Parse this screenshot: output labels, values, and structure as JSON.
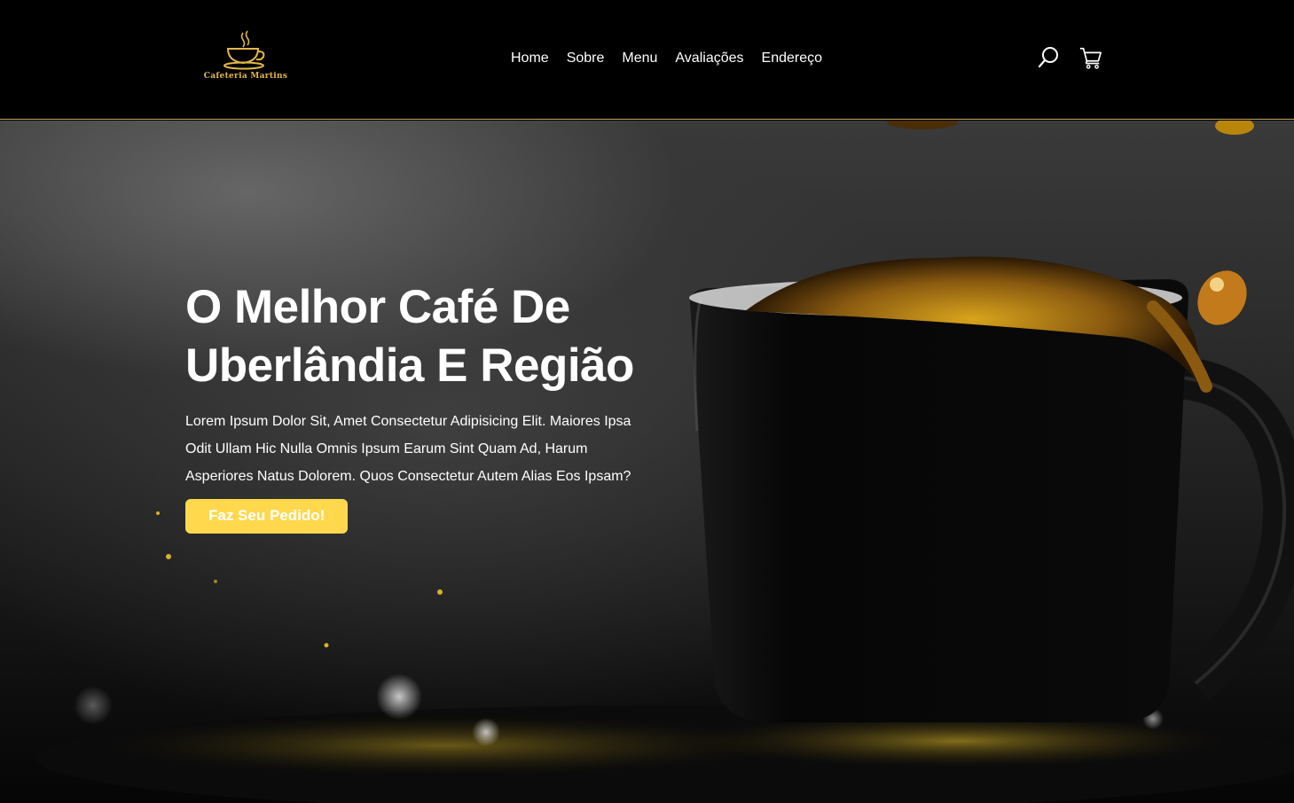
{
  "header": {
    "logo_text": "Cafeteria Martins",
    "nav": [
      {
        "label": "Home"
      },
      {
        "label": "Sobre"
      },
      {
        "label": "Menu"
      },
      {
        "label": "Avaliações"
      },
      {
        "label": "Endereço"
      }
    ],
    "icons": [
      "search-icon",
      "cart-icon"
    ]
  },
  "hero": {
    "title_line1": "O Melhor Café De",
    "title_line2": "Uberlândia E Região",
    "text_line1": "Lorem Ipsum Dolor Sit, Amet Consectetur Adipisicing Elit. Maiores Ipsa",
    "text_line2": "Odit Ullam Hic Nulla Omnis Ipsum Earum Sint Quam Ad, Harum",
    "text_line3": "Asperiores Natus Dolorem. Quos Consectetur Autem Alias Eos Ipsam?",
    "cta_label": "Faz Seu Pedido!"
  },
  "colors": {
    "accent": "#ffd84d",
    "logo_gold": "#e3b946",
    "header_bg": "#000000",
    "header_border": "#c9a55a"
  }
}
